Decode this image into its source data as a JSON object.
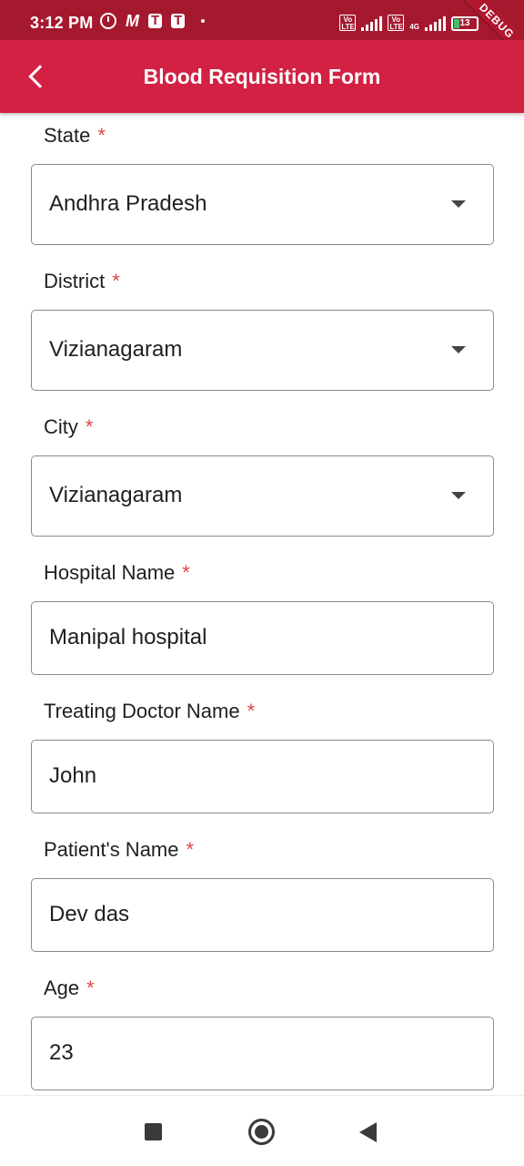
{
  "status_bar": {
    "time": "3:12 PM",
    "left_icons": [
      "alarm-icon",
      "m-app-icon",
      "teams-icon",
      "teams-icon",
      "dot-icon"
    ],
    "battery": "13",
    "network": "4G",
    "lte_label": "Vo LTE",
    "debug_label": "DEBUG"
  },
  "app_bar": {
    "title": "Blood Requisition Form",
    "back_icon": "chevron-left-icon",
    "color": "#d22143"
  },
  "form": {
    "required_marker": "*",
    "fields": [
      {
        "label": "State",
        "value": "Andhra Pradesh",
        "type": "dropdown"
      },
      {
        "label": "District",
        "value": "Vizianagaram",
        "type": "dropdown"
      },
      {
        "label": "City",
        "value": "Vizianagaram",
        "type": "dropdown"
      },
      {
        "label": "Hospital Name",
        "value": "Manipal hospital",
        "type": "text"
      },
      {
        "label": "Treating Doctor Name",
        "value": "John",
        "type": "text"
      },
      {
        "label": "Patient's Name",
        "value": "Dev das",
        "type": "text"
      },
      {
        "label": "Age",
        "value": "23",
        "type": "text"
      }
    ]
  },
  "nav_bar": {
    "icons": [
      "recents-icon",
      "home-icon",
      "back-icon"
    ]
  }
}
